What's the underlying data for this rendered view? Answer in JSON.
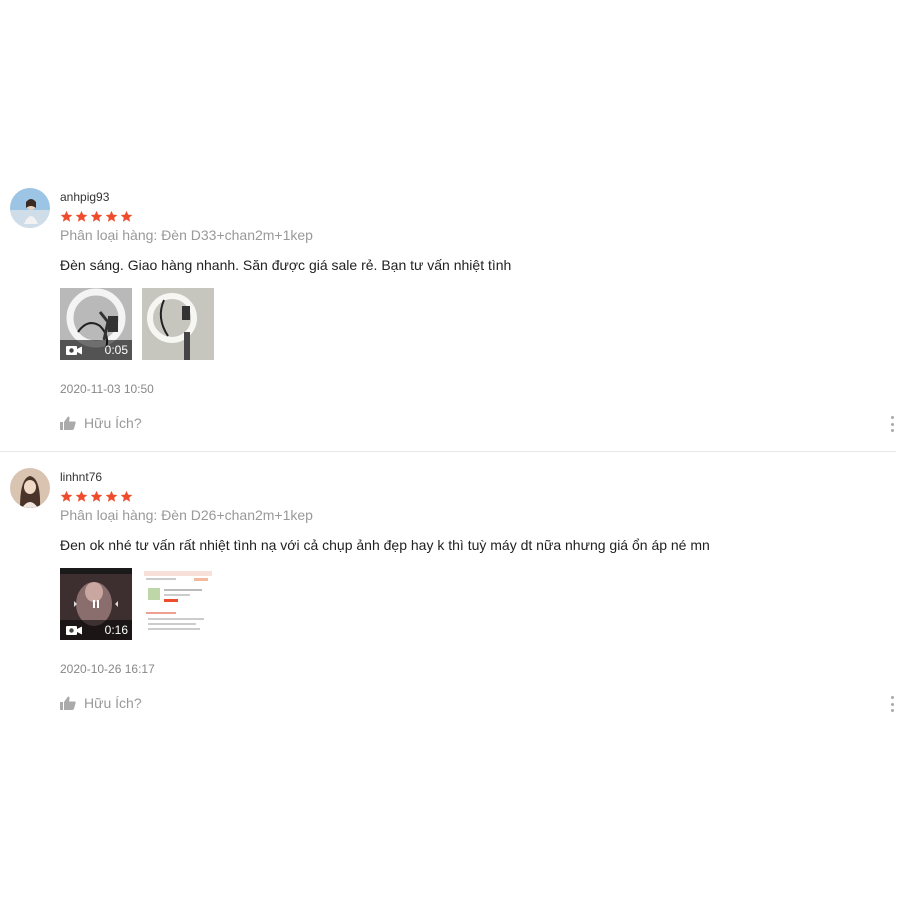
{
  "colors": {
    "star": "#ee4d2d",
    "muted": "#999999"
  },
  "reviews": [
    {
      "username": "anhpig93",
      "rating": 5,
      "variation": "Phân loại hàng: Đèn D33+chan2m+1kep",
      "comment": "Đèn sáng. Giao hàng nhanh. Săn được giá sale rẻ. Bạn tư vấn nhiệt tình",
      "media": [
        {
          "type": "video",
          "duration": "0:05",
          "icon": "video-camera-icon"
        },
        {
          "type": "image"
        }
      ],
      "timestamp": "2020-11-03 10:50",
      "helpful_label": "Hữu Ích?"
    },
    {
      "username": "linhnt76",
      "rating": 5,
      "variation": "Phân loại hàng: Đèn D26+chan2m+1kep",
      "comment": "Đen ok nhé tư vấn rất nhiệt tình nạ với cả chụp ảnh đẹp hay k thì tuỳ máy dt nữa nhưng giá ổn áp né mn",
      "media": [
        {
          "type": "video",
          "duration": "0:16",
          "icon": "video-camera-icon"
        },
        {
          "type": "image"
        }
      ],
      "timestamp": "2020-10-26 16:17",
      "helpful_label": "Hữu Ích?"
    }
  ]
}
